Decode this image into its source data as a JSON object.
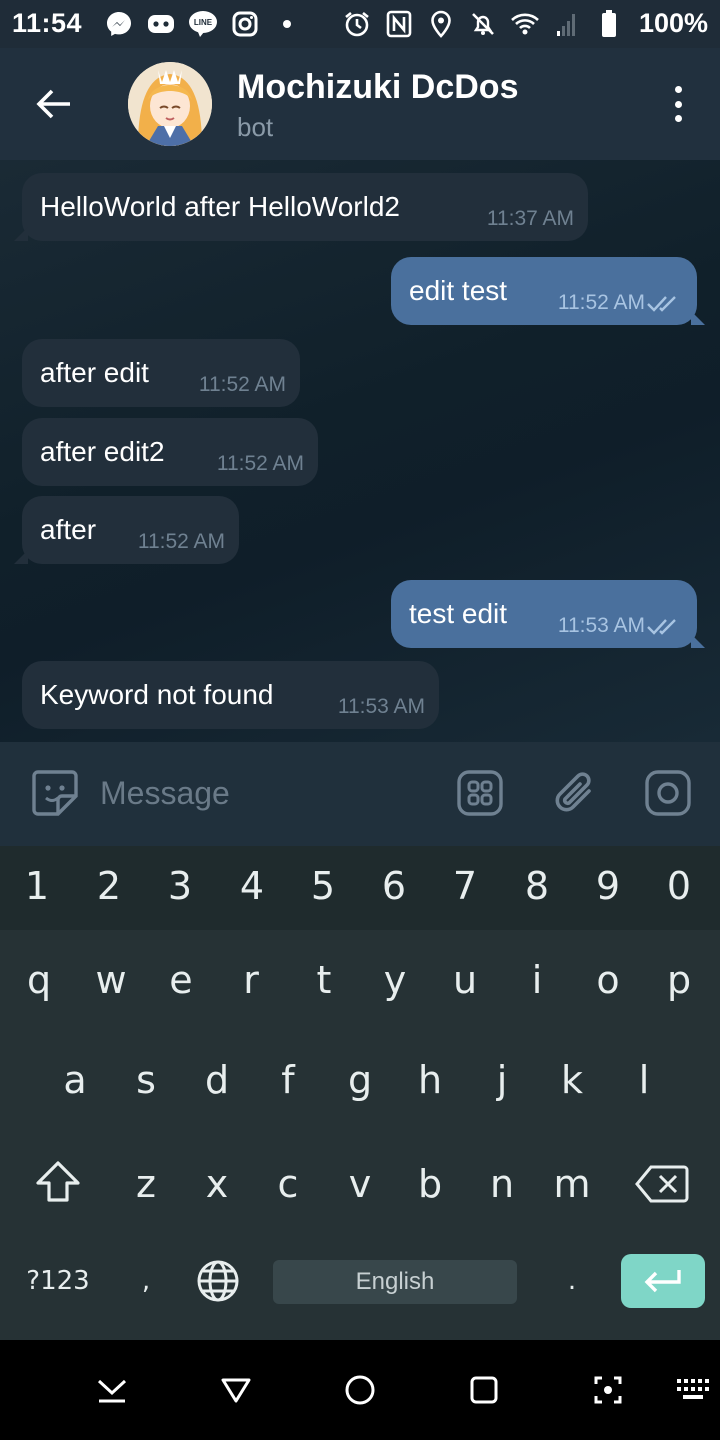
{
  "status_bar": {
    "time": "11:54",
    "battery": "100%",
    "notification_icons": [
      "messenger-icon",
      "discord-icon",
      "line-icon",
      "instagram-icon",
      "dot-icon"
    ],
    "system_icons": [
      "alarm-icon",
      "nfc-icon",
      "location-icon",
      "mute-icon",
      "wifi-icon",
      "signal-icon",
      "battery-icon"
    ]
  },
  "header": {
    "name": "Mochizuki DcDos",
    "status": "bot"
  },
  "messages": [
    {
      "dir": "in",
      "text": "HelloWorld after HelloWorld2",
      "time": "11:37 AM"
    },
    {
      "dir": "out",
      "text": "edit test",
      "time": "11:52 AM"
    },
    {
      "dir": "in",
      "text": "after edit",
      "time": "11:52 AM"
    },
    {
      "dir": "in",
      "text": "after edit2",
      "time": "11:52 AM"
    },
    {
      "dir": "in",
      "text": "after",
      "time": "11:52 AM"
    },
    {
      "dir": "out",
      "text": "test edit",
      "time": "11:53 AM"
    },
    {
      "dir": "in",
      "text": "Keyword not found",
      "time": "11:53 AM"
    }
  ],
  "input": {
    "placeholder": "Message",
    "value": ""
  },
  "keyboard": {
    "numbers": [
      "1",
      "2",
      "3",
      "4",
      "5",
      "6",
      "7",
      "8",
      "9",
      "0"
    ],
    "row1": [
      "q",
      "w",
      "e",
      "r",
      "t",
      "y",
      "u",
      "i",
      "o",
      "p"
    ],
    "row2": [
      "a",
      "s",
      "d",
      "f",
      "g",
      "h",
      "j",
      "k",
      "l"
    ],
    "row3": [
      "z",
      "x",
      "c",
      "v",
      "b",
      "n",
      "m"
    ],
    "symbols_key": "?123",
    "comma_key": ",",
    "space_label": "English",
    "period_key": "."
  },
  "colors": {
    "header_bg": "#21303e",
    "incoming_bubble": "#222f3b",
    "outgoing_bubble": "#4a709d",
    "enter_key": "#7fd6c7"
  }
}
